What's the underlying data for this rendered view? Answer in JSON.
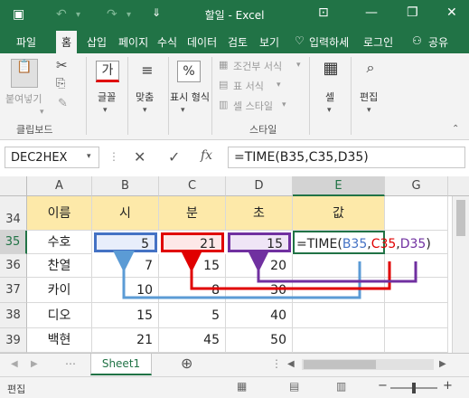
{
  "window": {
    "title": "할일 - Excel",
    "accent": "#217346"
  },
  "tabs": [
    "파일",
    "홈",
    "삽입",
    "페이지",
    "수식",
    "데이터",
    "검토",
    "보기"
  ],
  "tell_me": "입력하세",
  "account": "로그인",
  "share": "공유",
  "ribbon": {
    "clipboard": {
      "paste": "붙여넣기",
      "group": "클립보드"
    },
    "font": {
      "label": "글꼴"
    },
    "align": {
      "label": "맞춤"
    },
    "number": {
      "label": "표시 형식",
      "icon": "%"
    },
    "styles": {
      "conditional": "조건부 서식",
      "table": "표 서식",
      "cell_style": "셀 스타일",
      "group": "스타일"
    },
    "cells": {
      "label": "셀"
    },
    "edit": {
      "label": "편집"
    }
  },
  "formula_bar": {
    "name_box": "DEC2HEX",
    "formula": "=TIME(B35,C35,D35)"
  },
  "columns": [
    "A",
    "B",
    "C",
    "D",
    "E",
    "G"
  ],
  "rows": [
    {
      "num": "34",
      "a": "이름",
      "b": "시",
      "c": "분",
      "d": "초",
      "e": "값"
    },
    {
      "num": "35",
      "a": "수호",
      "b": "5",
      "c": "21",
      "d": "15",
      "e": "=TIME(B35,C35,D35)"
    },
    {
      "num": "36",
      "a": "찬열",
      "b": "7",
      "c": "15",
      "d": "20",
      "e": ""
    },
    {
      "num": "37",
      "a": "카이",
      "b": "10",
      "c": "8",
      "d": "30",
      "e": ""
    },
    {
      "num": "38",
      "a": "디오",
      "b": "15",
      "c": "5",
      "d": "40",
      "e": ""
    },
    {
      "num": "39",
      "a": "백현",
      "b": "21",
      "c": "45",
      "d": "50",
      "e": ""
    }
  ],
  "formula_parts": {
    "prefix": "=TIME(",
    "ref_b": "B35",
    "comma1": ",",
    "ref_c": "C35",
    "comma2": ",",
    "ref_d": "D35",
    "suffix": ")"
  },
  "ref_colors": {
    "b": "#4472c4",
    "c": "#e00000",
    "d": "#7030a0"
  },
  "sheet_tab": "Sheet1",
  "status": {
    "mode": "편집"
  }
}
